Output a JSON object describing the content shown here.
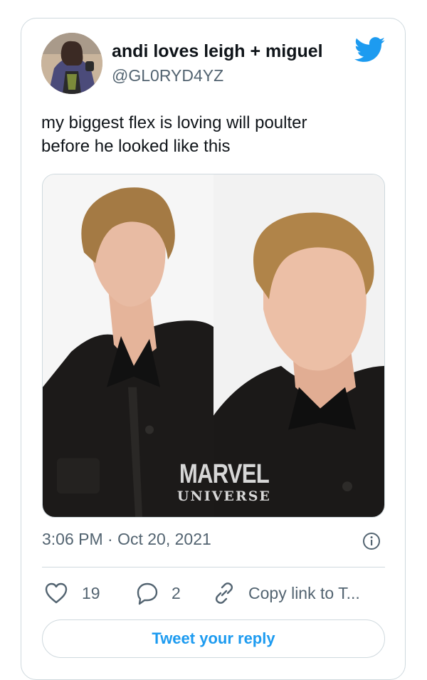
{
  "tweet": {
    "author_name": "andi loves leigh + miguel",
    "handle": "@GL0RYD4YZ",
    "text_lines": [
      "my biggest flex is loving will poulter",
      "before he looked like this"
    ],
    "timestamp": "3:06 PM · Oct 20, 2021",
    "media_watermark": {
      "line1": "MARVEL",
      "line2": "UNIVERSE"
    }
  },
  "actions": {
    "likes": "19",
    "replies": "2",
    "copy_link": "Copy link to T..."
  },
  "reply_prompt": "Tweet your reply",
  "colors": {
    "accent": "#1d9bf0",
    "secondary_text": "#536471",
    "border": "#cfd9de"
  },
  "icons": [
    "twitter-bird-icon",
    "info-icon",
    "heart-icon",
    "reply-icon",
    "link-icon"
  ]
}
